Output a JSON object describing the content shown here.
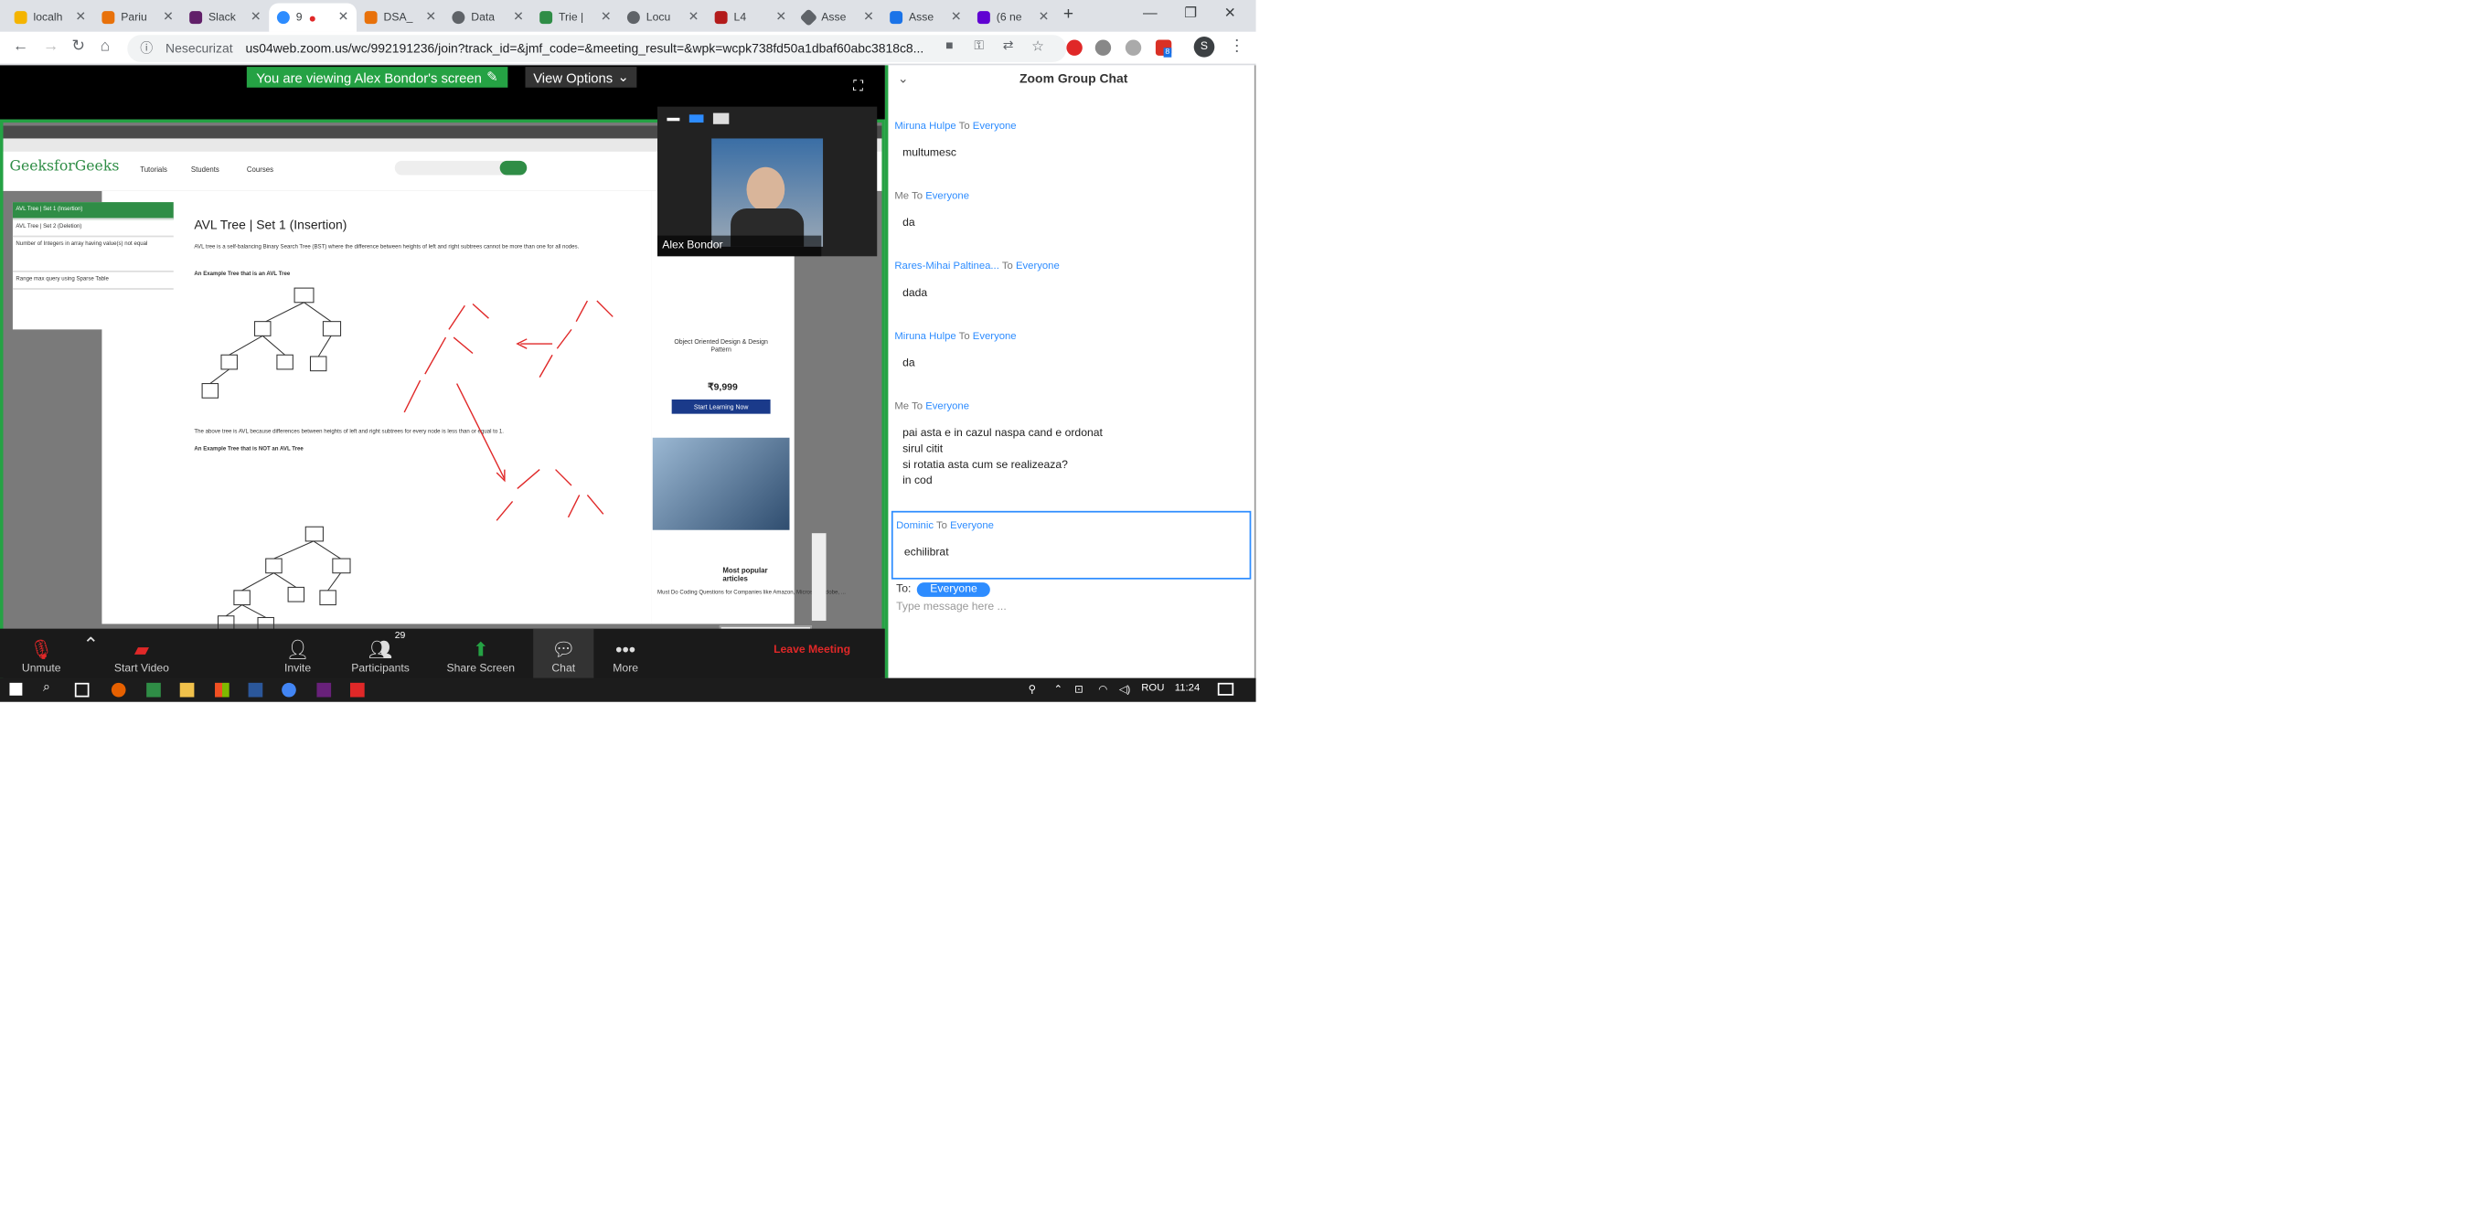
{
  "browser": {
    "tabs": [
      {
        "label": "localh",
        "color": "#f4b400"
      },
      {
        "label": "Pariu",
        "color": "#e8710a"
      },
      {
        "label": "Slack",
        "color": "#611f69"
      },
      {
        "label": "9",
        "color": "#2d8cff"
      },
      {
        "label": "DSA_",
        "color": "#e8710a"
      },
      {
        "label": "Data",
        "color": "#5f6368"
      },
      {
        "label": "Trie |",
        "color": "#2f8d46"
      },
      {
        "label": "Locu",
        "color": "#5f6368"
      },
      {
        "label": "L4",
        "color": "#b31b1b"
      },
      {
        "label": "Asse",
        "color": "#5f6368"
      },
      {
        "label": "Asse",
        "color": "#1a73e8"
      },
      {
        "label": "(6 ne",
        "color": "#6001d2"
      }
    ],
    "security_label": "Nesecurizat",
    "url": "us04web.zoom.us/wc/992191236/join?track_id=&jmf_code=&meeting_result=&wpk=wcpk738fd50a1dbaf60abc3818c8...",
    "profile_letter": "S",
    "badge_count": "8"
  },
  "zoom": {
    "banner": "You are viewing Alex Bondor's screen",
    "view_options": "View Options",
    "participant_name": "Alex Bondor",
    "toolbar": {
      "unmute": "Unmute",
      "start_video": "Start Video",
      "invite": "Invite",
      "participants": "Participants",
      "participants_count": "29",
      "share_screen": "Share Screen",
      "chat": "Chat",
      "more": "More",
      "leave": "Leave Meeting"
    }
  },
  "shared_screen": {
    "site_logo": "GeeksforGeeks",
    "menu": [
      "Tutorials",
      "Students",
      "Courses"
    ],
    "sidebar": [
      "AVL Tree | Set 1 (Insertion)",
      "AVL Tree | Set 2 (Deletion)",
      "Number of Integers in array having value(s) not equal",
      "Range max query using Sparse Table"
    ],
    "title": "AVL Tree | Set 1 (Insertion)",
    "intro": "AVL tree is a self-balancing Binary Search Tree (BST) where the difference between heights of left and right subtrees cannot be more than one for all nodes.",
    "h1": "An Example Tree that is an AVL Tree",
    "para2": "The above tree is AVL because differences between heights of left and right subtrees for every node is less than or equal to 1.",
    "h2": "An Example Tree that is NOT an AVL Tree",
    "ad_price": "₹9,999",
    "ad_button": "Start Learning Now",
    "ad_text": "Object Oriented Design & Design Pattern",
    "popular": "Most popular articles",
    "popular_item": "Must Do Coding Questions for Companies like Amazon, Microsoft, Adobe, ..."
  },
  "chat": {
    "title": "Zoom Group Chat",
    "messages": [
      {
        "from": "Miruna Hulpe",
        "to": "Everyone",
        "lines": [
          "multumesc"
        ]
      },
      {
        "from": "Me",
        "to": "Everyone",
        "lines": [
          "da"
        ]
      },
      {
        "from": "Rares-Mihai Paltinea...",
        "to": "Everyone",
        "lines": [
          "dada"
        ]
      },
      {
        "from": "Miruna Hulpe",
        "to": "Everyone",
        "lines": [
          "da"
        ]
      },
      {
        "from": "Me",
        "to": "Everyone",
        "lines": [
          "pai asta e in cazul naspa cand e ordonat",
          "sirul citit",
          "si rotatia asta cum se realizeaza?",
          "in cod"
        ]
      },
      {
        "from": "Dominic",
        "to": "Everyone",
        "lines": [
          "echilibrat"
        ]
      }
    ],
    "to_label": "To:",
    "to_value": "Everyone",
    "placeholder": "Type message here ...",
    "to_word": "To"
  },
  "taskbar": {
    "language": "ROU",
    "time": "11:24"
  }
}
